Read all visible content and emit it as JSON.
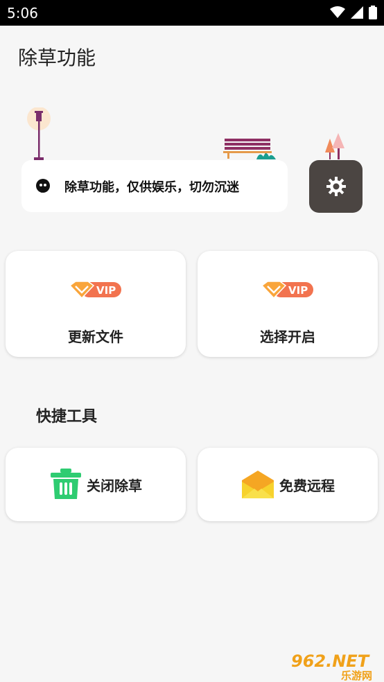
{
  "status": {
    "time": "5:06"
  },
  "app": {
    "title": "除草功能"
  },
  "notice": {
    "text": "除草功能，仅供娱乐，切勿沉迷"
  },
  "cards": {
    "update": {
      "badge": "VIP",
      "label": "更新文件"
    },
    "select": {
      "badge": "VIP",
      "label": "选择开启"
    }
  },
  "section": {
    "title": "快捷工具"
  },
  "tools": {
    "close": {
      "label": "关闭除草"
    },
    "free": {
      "label": "免费远程"
    }
  },
  "watermark": {
    "top": "962.NET",
    "bottom": "乐游网"
  },
  "colors": {
    "accent_vip": "#f08a3c",
    "settings_bg": "#4b4542",
    "trash_green": "#2ecc71",
    "mail_yellow": "#f7c82d"
  }
}
